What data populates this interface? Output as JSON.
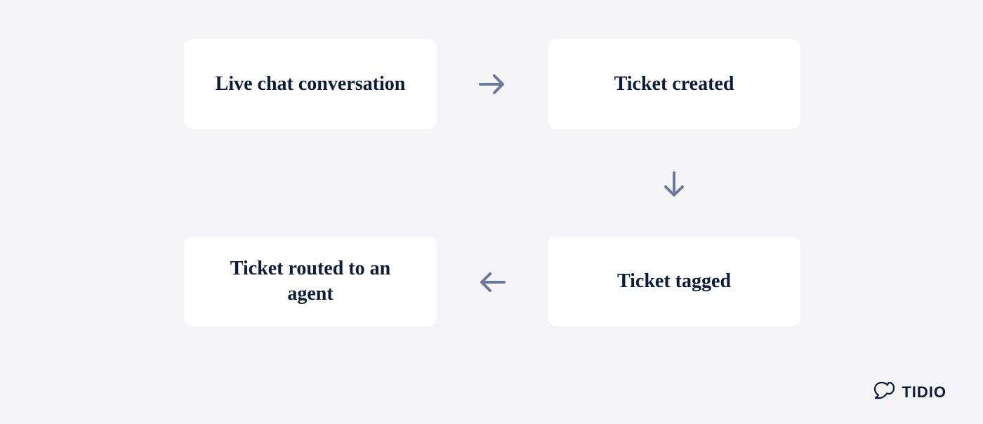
{
  "flow": {
    "steps": [
      {
        "label": "Live chat conversation"
      },
      {
        "label": "Ticket created"
      },
      {
        "label": "Ticket tagged"
      },
      {
        "label": "Ticket routed to an agent"
      }
    ],
    "arrows": {
      "right_icon": "arrow-right",
      "down_icon": "arrow-down",
      "left_icon": "arrow-left"
    }
  },
  "brand": {
    "name": "TIDIO",
    "logo_icon": "tidio-logo"
  },
  "colors": {
    "background": "#f5f5f7",
    "card": "#ffffff",
    "text": "#0c1c3a",
    "arrow": "#6b7a9a"
  }
}
